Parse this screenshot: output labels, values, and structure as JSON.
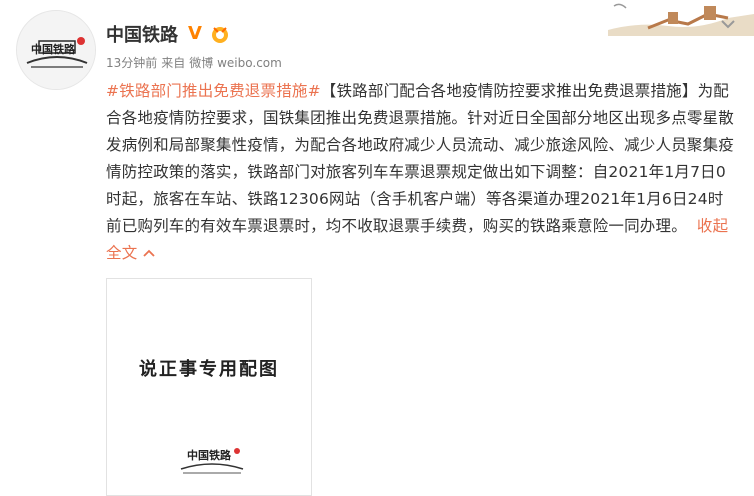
{
  "account": {
    "name": "中国铁路",
    "verified_icon": "verified-v-icon",
    "medal_icon": "fan-medal-icon",
    "avatar_logo_text": "中国铁路"
  },
  "meta": {
    "time": "13分钟前",
    "source_prefix": "来自",
    "source": "微博 weibo.com"
  },
  "post": {
    "topic": "#铁路部门推出免费退票措施#",
    "body": "【铁路部门配合各地疫情防控要求推出免费退票措施】为配合各地疫情防控要求，国铁集团推出免费退票措施。针对近日全国部分地区出现多点零星散发病例和局部聚集性疫情，为配合各地政府减少人员流动、减少旅途风险、减少人员聚集疫情防控政策的落实，铁路部门对旅客列车车票退票规定做出如下调整：自2021年1月7日0时起，旅客在车站、铁路12306网站（含手机客户端）等各渠道办理2021年1月6日24时前已购列车的有效车票退票时，均不收取退票手续费，购买的铁路乘意险一同办理。",
    "collapse_label": "收起全文",
    "collapse_icon": "chevron-up-icon"
  },
  "image": {
    "caption": "说正事专用配图",
    "logo_text": "中国铁路"
  },
  "colors": {
    "link": "#eb7350",
    "text": "#333333",
    "meta": "#808080",
    "verified": "#ff8200"
  }
}
